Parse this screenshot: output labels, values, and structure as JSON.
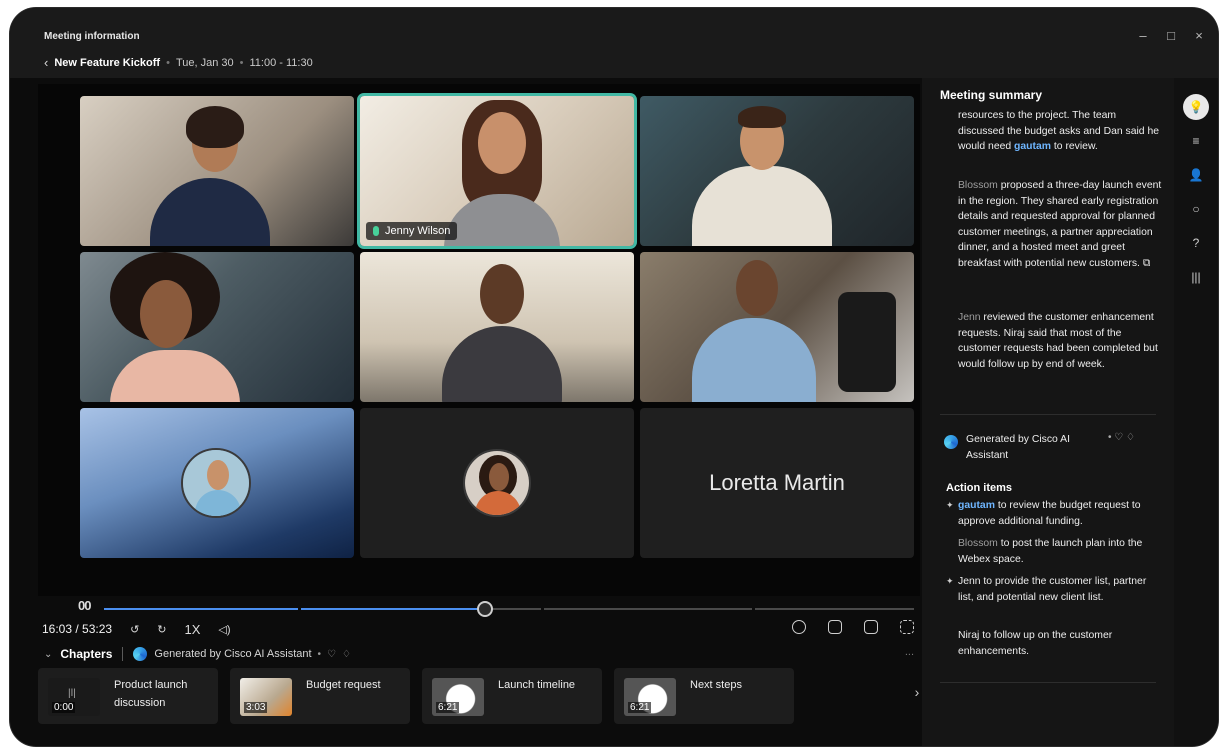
{
  "window": {
    "title": "Meeting information",
    "minimize": "–",
    "maximize": "□",
    "close": "×"
  },
  "breadcrumb": {
    "back": "‹",
    "meeting_title": "New Feature Kickoff",
    "date": "Tue, Jan 30",
    "time_range": "11:00 - 11:30",
    "separator": "•"
  },
  "video_grid": {
    "active_speaker": "Jenny Wilson",
    "text_tile": "Loretta Martin"
  },
  "player": {
    "play_pause": "00",
    "current_time": "16:03",
    "total_time": "53:23",
    "time_display": "16:03 / 53:23",
    "rewind": "↺",
    "forward": "↻",
    "speed": "1X",
    "volume": "◁)",
    "progress_fraction": 0.47
  },
  "chapters": {
    "toggle": "⌄",
    "label": "Chapters",
    "generated_by": "Generated by Cisco AI Assistant",
    "dot": "•",
    "thumbs_up": "♡",
    "thumbs_down": "♢",
    "more": "...",
    "next": "›",
    "items": [
      {
        "title": "Product launch discussion",
        "duration": "0:00"
      },
      {
        "title": "Budget request",
        "duration": "3:03"
      },
      {
        "title": "Launch timeline",
        "duration": "6:21"
      },
      {
        "title": "Next steps",
        "duration": "6:21"
      }
    ]
  },
  "summary": {
    "title": "Meeting summary",
    "para1_a": "resources to the project. The team discussed the budget asks and Dan said he would need ",
    "para1_mention": "gautam",
    "para1_b": " to review.",
    "para2_name": "Blossom",
    "para2_text": " proposed a three-day launch event in the region. They shared early registration details and requested approval for planned customer meetings, a partner appreciation dinner, and a hosted meet and greet breakfast with potential new customers.",
    "para2_icon": "⧉",
    "para3_name": "Jenn",
    "para3_text": " reviewed the customer enhancement requests. Niraj said that most of the customer requests had been completed but would follow up by end of week.",
    "generated_by": "Generated by Cisco AI Assistant",
    "feedback": "• ♡ ♢",
    "action_items_label": "Action items",
    "action_items": [
      {
        "bullet": "✦",
        "mention": "gautam",
        "text": " to review the budget request to approve additional funding."
      },
      {
        "bullet": "",
        "name": "Blossom",
        "text": " to post the launch plan into the Webex space."
      },
      {
        "bullet": "✦",
        "text": "Jenn to provide the customer list, partner list, and potential new client list."
      },
      {
        "bullet": "",
        "text": "Niraj to follow up on the customer enhancements."
      }
    ]
  },
  "rail": {
    "items": [
      "💡",
      "≡",
      "👤",
      "○",
      "?",
      "|||"
    ]
  }
}
